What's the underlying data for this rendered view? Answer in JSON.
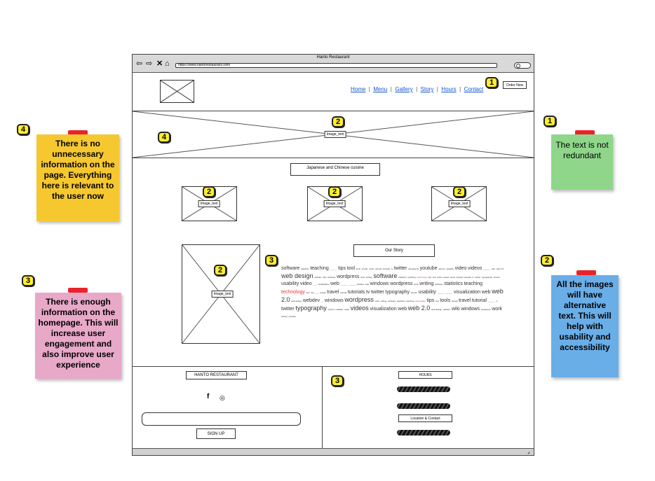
{
  "window": {
    "title": "Hanto Restaurant",
    "url": "https://www.hantorestaurant.com/"
  },
  "nav": {
    "links": [
      "Home",
      "Menu",
      "Gallery",
      "Story",
      "Hours",
      "Contact"
    ],
    "order_button": "Order Now"
  },
  "hero": {
    "image_label": "Image_text"
  },
  "cuisine": {
    "title": "Japanese and Chinese cuisine",
    "images": [
      "Image_text",
      "Image_text",
      "Image_text"
    ]
  },
  "story": {
    "title": "Our Story",
    "image_label": "Image_text",
    "cloud": [
      [
        "software",
        "md"
      ],
      [
        "statistics",
        "sm"
      ],
      [
        "teaching",
        "md"
      ],
      [
        "______",
        "sm red"
      ],
      [
        "tips",
        "md"
      ],
      [
        "tool",
        "md"
      ],
      [
        "tools",
        "sm"
      ],
      [
        "toread",
        "sm"
      ],
      [
        "travel",
        "sm"
      ],
      [
        "tutorial",
        "sm"
      ],
      [
        "tutorials",
        "sm"
      ],
      [
        "tv",
        "sm"
      ],
      [
        "twitter",
        "md"
      ],
      [
        "typography",
        "sm"
      ],
      [
        "youtube",
        "md"
      ],
      [
        "ubuntu",
        "sm"
      ],
      [
        "usability",
        "sm"
      ],
      [
        "video",
        "md"
      ],
      [
        "videos",
        "md"
      ],
      [
        "______",
        "sm"
      ],
      [
        "web",
        "sm"
      ],
      [
        "web 2.0",
        "sm"
      ],
      [
        "web design",
        "lg"
      ],
      [
        "webdev",
        "sm"
      ],
      [
        "wiki",
        "sm"
      ],
      [
        "windows",
        "sm"
      ],
      [
        "wordpress",
        "md"
      ],
      [
        "work",
        "sm"
      ],
      [
        "writing",
        "sm"
      ],
      [
        "software",
        "lg"
      ],
      [
        "statistics",
        "sm"
      ],
      [
        "teaching",
        "sm"
      ],
      [
        "technology",
        "sm red"
      ],
      [
        "tips",
        "sm"
      ],
      [
        "tool",
        "sm"
      ],
      [
        "tools",
        "sm"
      ],
      [
        "toread",
        "sm"
      ],
      [
        "travel",
        "sm"
      ],
      [
        "tutorial",
        "sm"
      ],
      [
        "tutorials",
        "sm"
      ],
      [
        "tv",
        "sm"
      ],
      [
        "twitter",
        "sm"
      ],
      [
        "typography",
        "sm"
      ],
      [
        "ubuntu",
        "sm"
      ],
      [
        "usability",
        "md"
      ],
      [
        "video",
        "md"
      ],
      [
        "___",
        "sm"
      ],
      [
        "visualization",
        "sm"
      ],
      [
        "web",
        "md"
      ],
      [
        "______",
        "sm"
      ],
      [
        "______",
        "sm"
      ],
      [
        "webdev",
        "sm"
      ],
      [
        "wiki",
        "sm"
      ],
      [
        "windows",
        "md"
      ],
      [
        "wordpress",
        "md"
      ],
      [
        "work",
        "sm"
      ],
      [
        "writing",
        "md"
      ],
      [
        "software",
        "sm"
      ],
      [
        "statistics",
        "md"
      ],
      [
        "teaching",
        "md"
      ],
      [
        "technology",
        "md red"
      ],
      [
        "tips",
        "sm"
      ],
      [
        "tool",
        "sm"
      ],
      [
        "___",
        "sm"
      ],
      [
        "toread",
        "sm"
      ],
      [
        "travel",
        "md"
      ],
      [
        "tutorial",
        "sm"
      ],
      [
        "tutorials",
        "md"
      ],
      [
        "tv",
        "md"
      ],
      [
        "twitter",
        "md"
      ],
      [
        "typography",
        "md"
      ],
      [
        "ubuntu",
        "sm"
      ],
      [
        "usability",
        "md"
      ],
      [
        "______",
        "sm"
      ],
      [
        "______",
        "sm"
      ],
      [
        "visualization",
        "md"
      ],
      [
        "web",
        "md"
      ],
      [
        "web 2.0",
        "lg"
      ],
      [
        "web design",
        "sm"
      ],
      [
        "webdev",
        "md"
      ],
      [
        "__",
        "sm"
      ],
      [
        "windows",
        "md"
      ],
      [
        "wordpress",
        "lg"
      ],
      [
        "work",
        "sm"
      ],
      [
        "writing",
        "sm"
      ],
      [
        "software",
        "sm"
      ],
      [
        "statistics",
        "sm"
      ],
      [
        "teaching",
        "sm"
      ],
      [
        "technology",
        "sm red"
      ],
      [
        "tips",
        "md"
      ],
      [
        "tool",
        "sm"
      ],
      [
        "tools",
        "md"
      ],
      [
        "toread",
        "sm"
      ],
      [
        "travel",
        "md"
      ],
      [
        "tutorial",
        "md"
      ],
      [
        "______",
        "sm"
      ],
      [
        "tv",
        "sm"
      ],
      [
        "twitter",
        "md"
      ],
      [
        "typography",
        "lg"
      ],
      [
        "ubuntu",
        "sm"
      ],
      [
        "usability",
        "sm"
      ],
      [
        "video",
        "sm"
      ],
      [
        "videos",
        "lg"
      ],
      [
        "visualization",
        "md"
      ],
      [
        "web",
        "md"
      ],
      [
        "web 2.0",
        "lg"
      ],
      [
        "web design",
        "sm"
      ],
      [
        "webdev",
        "sm"
      ],
      [
        "wiki",
        "md"
      ],
      [
        "windows",
        "md"
      ],
      [
        "wordpress",
        "sm"
      ],
      [
        "work",
        "md"
      ],
      [
        "writing",
        "sm"
      ],
      [
        "youtube",
        "sm"
      ]
    ]
  },
  "footer_left": {
    "title": "HANTO RESTAURANT",
    "social": [
      "f",
      "◎"
    ],
    "signup": "SIGN UP"
  },
  "footer_right": {
    "hours_title": "HOURS",
    "location_title": "Location & Contact"
  },
  "badges": {
    "one": "1",
    "two": "2",
    "three": "3",
    "four": "4"
  },
  "notes": {
    "no_unnecessary": "There is no unnecessary information on the page. Everything here is relevant to the user now",
    "enough_info": "There is enough information on the homepage. This will increase user engagement and also improve user experience",
    "not_redundant": "The text is not redundant",
    "alt_text": "All the images will have alternative text. This will help with usability and accessibility"
  },
  "colors": {
    "note_yellow": "#f6c830",
    "note_pink": "#e8a8c8",
    "note_green": "#8fd68a",
    "note_blue": "#6aaee8",
    "link_blue": "#1155cc",
    "badge_yellow": "#ffee2e",
    "pin_red": "#e8242a"
  }
}
